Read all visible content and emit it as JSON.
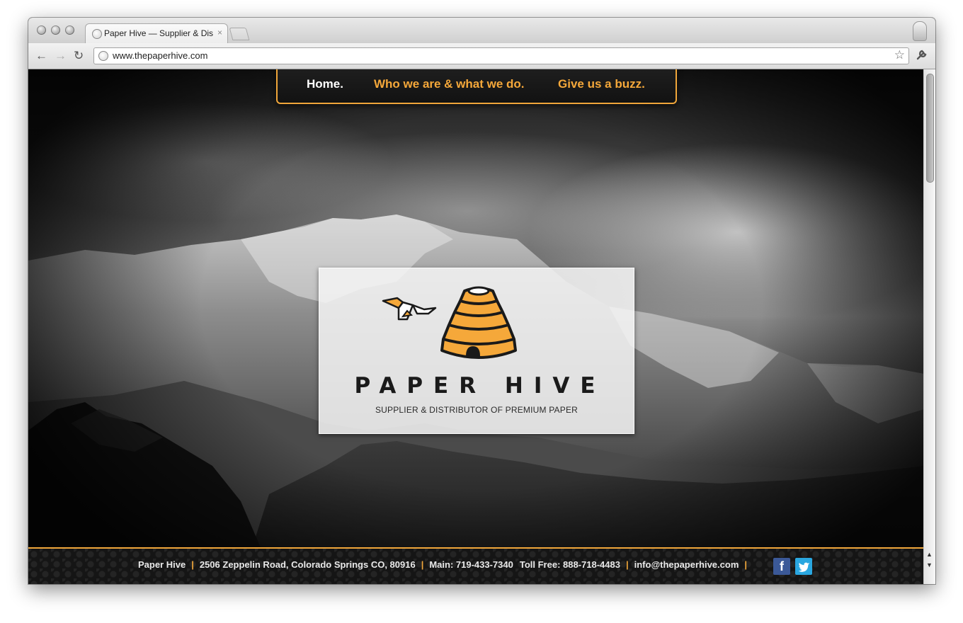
{
  "browser": {
    "tab_title": "Paper Hive — Supplier & Distributor of Premium Paper",
    "tab_close": "×",
    "url": "www.thepaperhive.com",
    "back_icon": "←",
    "forward_icon": "→",
    "reload_icon": "↻",
    "star_icon": "☆",
    "wrench_icon": "🔧"
  },
  "nav": {
    "home": "Home.",
    "who": "Who we are & what we do.",
    "buzz": "Give us a buzz."
  },
  "logo": {
    "name": "PAPER HIVE",
    "tagline": "SUPPLIER & DISTRIBUTOR OF PREMIUM PAPER"
  },
  "footer": {
    "company": "Paper Hive",
    "address": "2506 Zeppelin Road, Colorado Springs CO, 80916",
    "main_phone": "Main: 719-433-7340",
    "toll_free": "Toll Free: 888-718-4483",
    "email": "info@thepaperhive.com",
    "separator": "|",
    "facebook_glyph": "f",
    "twitter_glyph": "t"
  },
  "colors": {
    "accent": "#f0a63a",
    "nav_background": "#1a1a1a",
    "facebook": "#3b5998",
    "twitter": "#2aa7e0"
  },
  "icons": [
    "globe-icon",
    "back-arrow-icon",
    "forward-arrow-icon",
    "reload-icon",
    "bookmark-star-icon",
    "wrench-icon",
    "profile-icon",
    "facebook-icon",
    "twitter-icon",
    "hive-logo-icon",
    "paper-bird-icon"
  ]
}
